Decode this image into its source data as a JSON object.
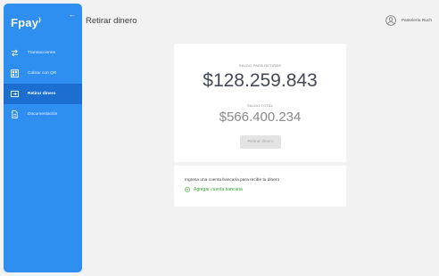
{
  "sidebar": {
    "logo": "Fpay",
    "logo_mark": "⁾",
    "collapse_icon": "back-arrow-icon",
    "items": [
      {
        "label": "Transacciones",
        "icon": "transfer-arrows-icon",
        "active": false
      },
      {
        "label": "Cobrar con QR",
        "icon": "qr-code-icon",
        "active": false
      },
      {
        "label": "Retirar dinero",
        "icon": "withdraw-screen-icon",
        "active": true
      },
      {
        "label": "Documentación",
        "icon": "document-icon",
        "active": false
      }
    ]
  },
  "header": {
    "title": "Retirar dinero",
    "user_name": "Pastelería Ruch"
  },
  "balance": {
    "withdraw_label": "SALDO PARA RETIRAR",
    "withdraw_amount": "$128.259.843",
    "total_label": "SALDO TOTAL",
    "total_amount": "$566.400.234",
    "button_label": "Retirar dinero"
  },
  "bank_account": {
    "prompt": "Ingresa una cuenta bancaria para recibir tu dinero",
    "add_label": "Agregar cuenta bancaria"
  },
  "colors": {
    "sidebar": "#2f8ff0",
    "sidebar_active": "#1c6fd1",
    "link_green": "#3aa235",
    "background": "#f2f2f2"
  }
}
